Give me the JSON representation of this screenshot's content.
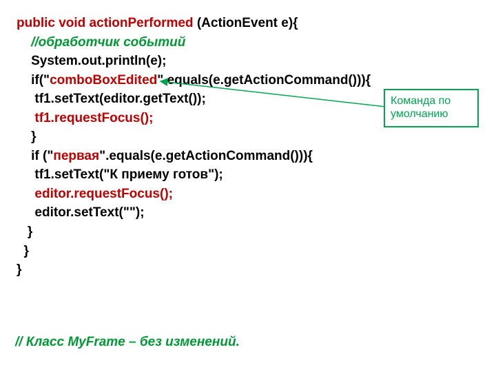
{
  "code": {
    "l1a": "public void actionPerformed",
    "l1b": " (ActionEvent e){",
    "l2": "    //обработчик событий",
    "l3": "    System.out.println(e);",
    "l4a": "    if(\"",
    "l4b": "comboBoxEdited",
    "l4c": "\".equals(e.getActionCommand())){",
    "l5": "     tf1.setText(editor.getText());",
    "l6": "     tf1.requestFocus();",
    "l7": "    }",
    "l8a": "    if (\"",
    "l8b": "первая",
    "l8c": "\".equals(e.getActionCommand())){",
    "l9": "     tf1.setText(\"К приему готов\");",
    "l10": "     editor.requestFocus();",
    "l11": "     editor.setText(\"\");",
    "l12": "   }",
    "l13": "  }",
    "l14": "}"
  },
  "callout": {
    "text": "Команда по умолчанию"
  },
  "footer": {
    "text": "// Класс MyFrame – без изменений."
  },
  "colors": {
    "keyword_red": "#c00000",
    "comment_green": "#009933",
    "callout_green": "#00a651",
    "text_black": "#000000"
  }
}
